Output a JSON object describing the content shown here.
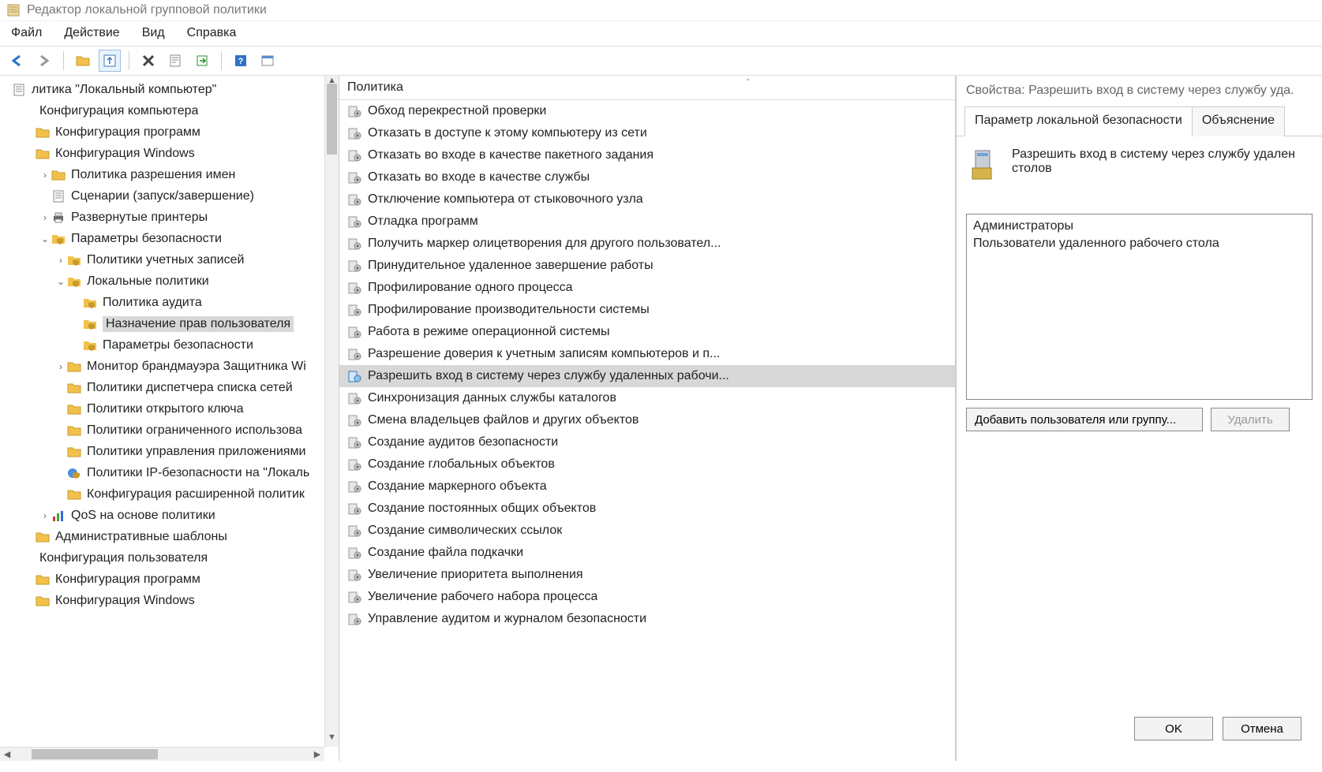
{
  "window": {
    "title": "Редактор локальной групповой политики"
  },
  "menu": {
    "file": "Файл",
    "action": "Действие",
    "view": "Вид",
    "help": "Справка"
  },
  "tree": {
    "root": "литика \"Локальный компьютер\"",
    "computer_config": "Конфигурация компьютера",
    "soft_config": "Конфигурация программ",
    "windows_config": "Конфигурация Windows",
    "name_resolution": "Политика разрешения имен",
    "scripts": "Сценарии (запуск/завершение)",
    "deployed_printers": "Развернутые принтеры",
    "security_settings": "Параметры безопасности",
    "account_policies": "Политики учетных записей",
    "local_policies": "Локальные политики",
    "audit_policy": "Политика аудита",
    "user_rights": "Назначение прав пользователя",
    "security_options": "Параметры безопасности",
    "firewall_monitor": "Монитор брандмауэра Защитника Wi",
    "nla_policies": "Политики диспетчера списка сетей",
    "public_key": "Политики открытого ключа",
    "software_restriction": "Политики ограниченного использова",
    "app_control": "Политики управления приложениями",
    "ipsec": "Политики IP-безопасности на \"Локаль",
    "advanced_audit": "Конфигурация расширенной политик",
    "qos": "QoS на основе политики",
    "admin_templates": "Административные шаблоны",
    "user_config": "Конфигурация пользователя",
    "user_soft": "Конфигурация программ",
    "user_windows": "Конфигурация Windows"
  },
  "list": {
    "header": "Политика",
    "items": [
      "Обход перекрестной проверки",
      "Отказать в доступе к этому компьютеру из сети",
      "Отказать во входе в качестве пакетного задания",
      "Отказать во входе в качестве службы",
      "Отключение компьютера от стыковочного узла",
      "Отладка программ",
      "Получить маркер олицетворения для другого пользовател...",
      "Принудительное удаленное завершение работы",
      "Профилирование одного процесса",
      "Профилирование производительности системы",
      "Работа в режиме операционной системы",
      "Разрешение доверия к учетным записям компьютеров и п...",
      "Разрешить вход в систему через службу удаленных рабочи...",
      "Синхронизация данных службы каталогов",
      "Смена владельцев файлов и других объектов",
      "Создание аудитов безопасности",
      "Создание глобальных объектов",
      "Создание маркерного объекта",
      "Создание постоянных общих объектов",
      "Создание символических ссылок",
      "Создание файла подкачки",
      "Увеличение приоритета выполнения",
      "Увеличение рабочего набора процесса",
      "Управление аудитом и журналом безопасности"
    ],
    "selected_index": 12
  },
  "dialog": {
    "title": "Свойства: Разрешить вход в систему через службу уда.",
    "tab_local": "Параметр локальной безопасности",
    "tab_explain": "Объяснение",
    "policy_name": "Разрешить вход в систему через службу удален столов",
    "members": [
      "Администраторы",
      "Пользователи удаленного рабочего стола"
    ],
    "btn_add": "Добавить пользователя или группу...",
    "btn_remove": "Удалить",
    "btn_ok": "OK",
    "btn_cancel": "Отмена"
  }
}
